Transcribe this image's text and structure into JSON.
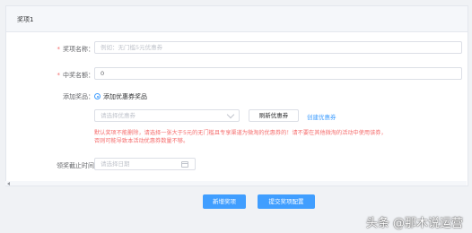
{
  "panel": {
    "title": "奖项1"
  },
  "form": {
    "prize_name": {
      "label": "奖项名称：",
      "placeholder": "例如：无门槛5元优惠券",
      "value": ""
    },
    "win_count": {
      "label": "中奖名额：",
      "value": "0"
    },
    "add_prize": {
      "label": "添加奖品：",
      "option_label": "添加优惠券奖品",
      "coupon_select_placeholder": "请选择优惠券",
      "refresh_label": "刷新优惠券",
      "create_label": "创建优惠券"
    },
    "warning_text_line1": "默认奖项不能删除，请选择一张大于5元的无门槛且专享渠道为微淘的优惠券的！请不要在其他微淘的活动中使用该券，",
    "warning_text_line2": "否则可能导致本活动优惠券数量不够。",
    "deadline": {
      "label": "领奖截止时间",
      "placeholder": "请选择日期"
    }
  },
  "actions": {
    "add_prize_label": "新增奖项",
    "submit_label": "提交奖项配置"
  },
  "watermark": "头条 @那木说运营",
  "colors": {
    "accent": "#409eff",
    "required": "#f56c6c",
    "warning": "#f56c6c"
  },
  "icons": {
    "select_arrow": "chevron-down-icon",
    "date": "calendar-icon",
    "scroll": "scroll-left-arrow-icon"
  }
}
